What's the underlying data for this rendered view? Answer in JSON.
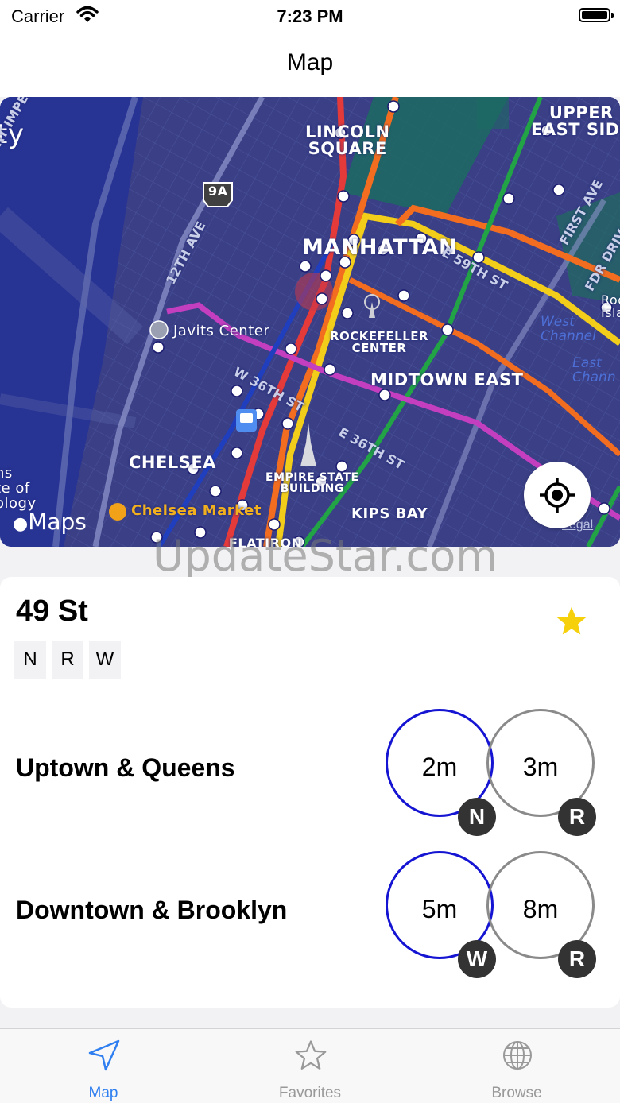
{
  "status_bar": {
    "carrier": "Carrier",
    "time": "7:23 PM"
  },
  "nav": {
    "title": "Map"
  },
  "map": {
    "labels": {
      "lincoln_square": "LINCOLN\nSQUARE",
      "upper_east_side": "UPPER\nEAST SIDE",
      "manhattan": "MANHATTAN",
      "javits": "Javits Center",
      "rockefeller": "ROCKEFELLER\nCENTER",
      "midtown_east": "MIDTOWN EAST",
      "chelsea": "CHELSEA",
      "empire": "EMPIRE STATE\nBUILDING",
      "kips_bay": "KIPS BAY",
      "chelsea_market": "Chelsea Market",
      "flatiron": "FLATIRON",
      "city_fragment": "ty",
      "highway_9a": "9A",
      "west_channel": "West\nChannel",
      "east_channel": "East\nChann",
      "roosevelt": "Roose\nIsla",
      "fashion_inst": "ns\nte of\nology"
    },
    "streets": {
      "imperial": "PORT IMPERIAL BLV",
      "twelfth": "12TH AVE",
      "e59": "E 59TH ST",
      "w36": "W 36TH ST",
      "e36": "E 36TH ST",
      "first_ave": "FIRST AVE",
      "fdr": "FDR DRIV"
    },
    "maps_logo": "Maps",
    "legal": "Legal",
    "locate_button": "locate"
  },
  "watermark": "UpdateStar.com",
  "station": {
    "name": "49 St",
    "routes": [
      "N",
      "R",
      "W"
    ],
    "favorite": true,
    "favorite_color": "#f5d00b"
  },
  "directions": [
    {
      "label": "Uptown & Queens",
      "arrivals": [
        {
          "time": "2m",
          "line": "N"
        },
        {
          "time": "3m",
          "line": "R"
        }
      ]
    },
    {
      "label": "Downtown & Brooklyn",
      "arrivals": [
        {
          "time": "5m",
          "line": "W"
        },
        {
          "time": "8m",
          "line": "R"
        }
      ]
    }
  ],
  "tabs": [
    {
      "label": "Map",
      "icon": "navigation-arrow-icon",
      "active": true
    },
    {
      "label": "Favorites",
      "icon": "star-icon",
      "active": false
    },
    {
      "label": "Browse",
      "icon": "globe-icon",
      "active": false
    }
  ],
  "colors": {
    "accent": "#2f7ff0",
    "first_arrival_ring": "#1414d2",
    "second_arrival_ring": "#8a8a8a",
    "map_background": "#232f86"
  }
}
